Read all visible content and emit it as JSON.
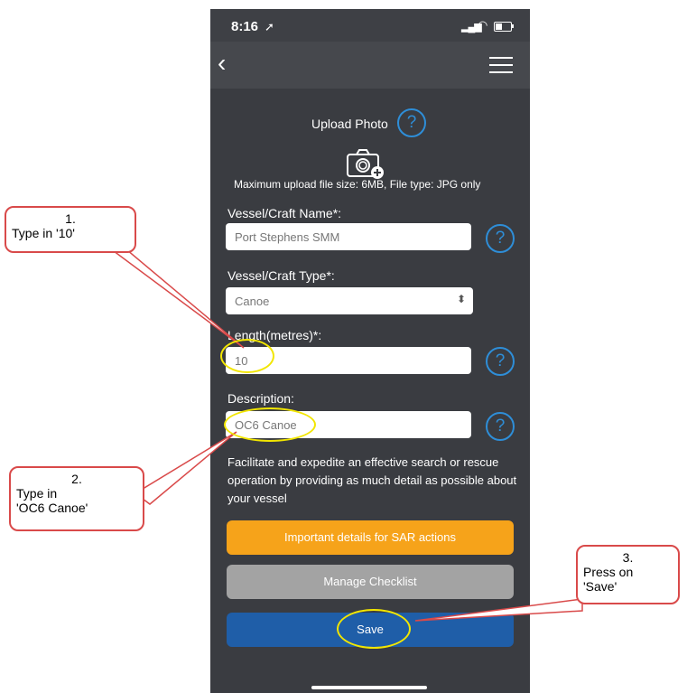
{
  "status": {
    "time": "8:16",
    "location_icon": "location-arrow-icon"
  },
  "nav": {
    "back_icon": "back-chevron-icon",
    "menu_icon": "hamburger-menu-icon"
  },
  "upload": {
    "label": "Upload Photo",
    "help": "?",
    "note": "Maximum upload file size: 6MB, File type: JPG only"
  },
  "fields": {
    "name": {
      "label": "Vessel/Craft Name*:",
      "value": "Port Stephens SMM"
    },
    "type": {
      "label": "Vessel/Craft Type*:",
      "value": "Canoe"
    },
    "length": {
      "label": "Length(metres)*:",
      "value": "10"
    },
    "description": {
      "label": "Description:",
      "value": "OC6 Canoe"
    }
  },
  "help_text": "Facilitate and expedite an effective search or rescue operation by providing as much detail as possible about your vessel",
  "buttons": {
    "sar": "Important details for SAR actions",
    "checklist": "Manage Checklist",
    "save": "Save"
  },
  "callouts": {
    "c1": {
      "num": "1.",
      "text": "Type in '10'"
    },
    "c2": {
      "num": "2.",
      "text": "Type in 'OC6 Canoe'"
    },
    "c3": {
      "num": "3.",
      "text": "Press on 'Save'"
    }
  },
  "colors": {
    "background": "#3a3c41",
    "help_blue": "#2e8ed8",
    "sar_orange": "#f6a31a",
    "checklist_grey": "#a3a3a3",
    "save_blue": "#1f5ea8",
    "highlight_yellow": "#f2e600",
    "callout_red": "#d94a4a"
  }
}
